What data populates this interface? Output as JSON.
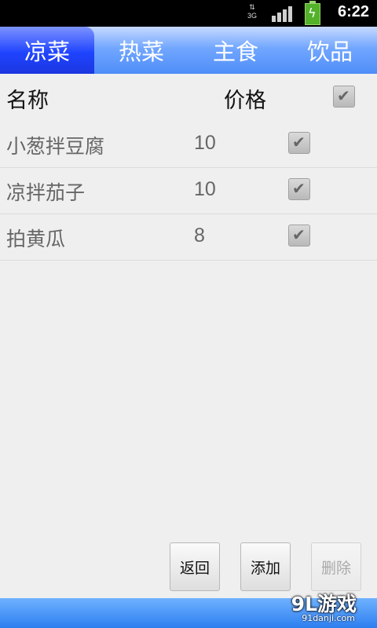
{
  "status_bar": {
    "network": "3G",
    "time": "6:22"
  },
  "tabs": [
    {
      "label": "凉菜",
      "active": true
    },
    {
      "label": "热菜",
      "active": false
    },
    {
      "label": "主食",
      "active": false
    },
    {
      "label": "饮品",
      "active": false
    }
  ],
  "table": {
    "header": {
      "name": "名称",
      "price": "价格",
      "select_all_checked": true
    },
    "rows": [
      {
        "name": "小葱拌豆腐",
        "price": "10",
        "checked": true
      },
      {
        "name": "凉拌茄子",
        "price": "10",
        "checked": true
      },
      {
        "name": "拍黄瓜",
        "price": "8",
        "checked": true
      }
    ]
  },
  "buttons": {
    "back": "返回",
    "add": "添加",
    "delete": "删除"
  },
  "watermark": {
    "brand": "9L游戏",
    "site": "91danji.com"
  },
  "colors": {
    "active_tab": "#1f44ff",
    "tab_bar": "#72a7ff",
    "bottom_bar": "#2d7ef0"
  }
}
